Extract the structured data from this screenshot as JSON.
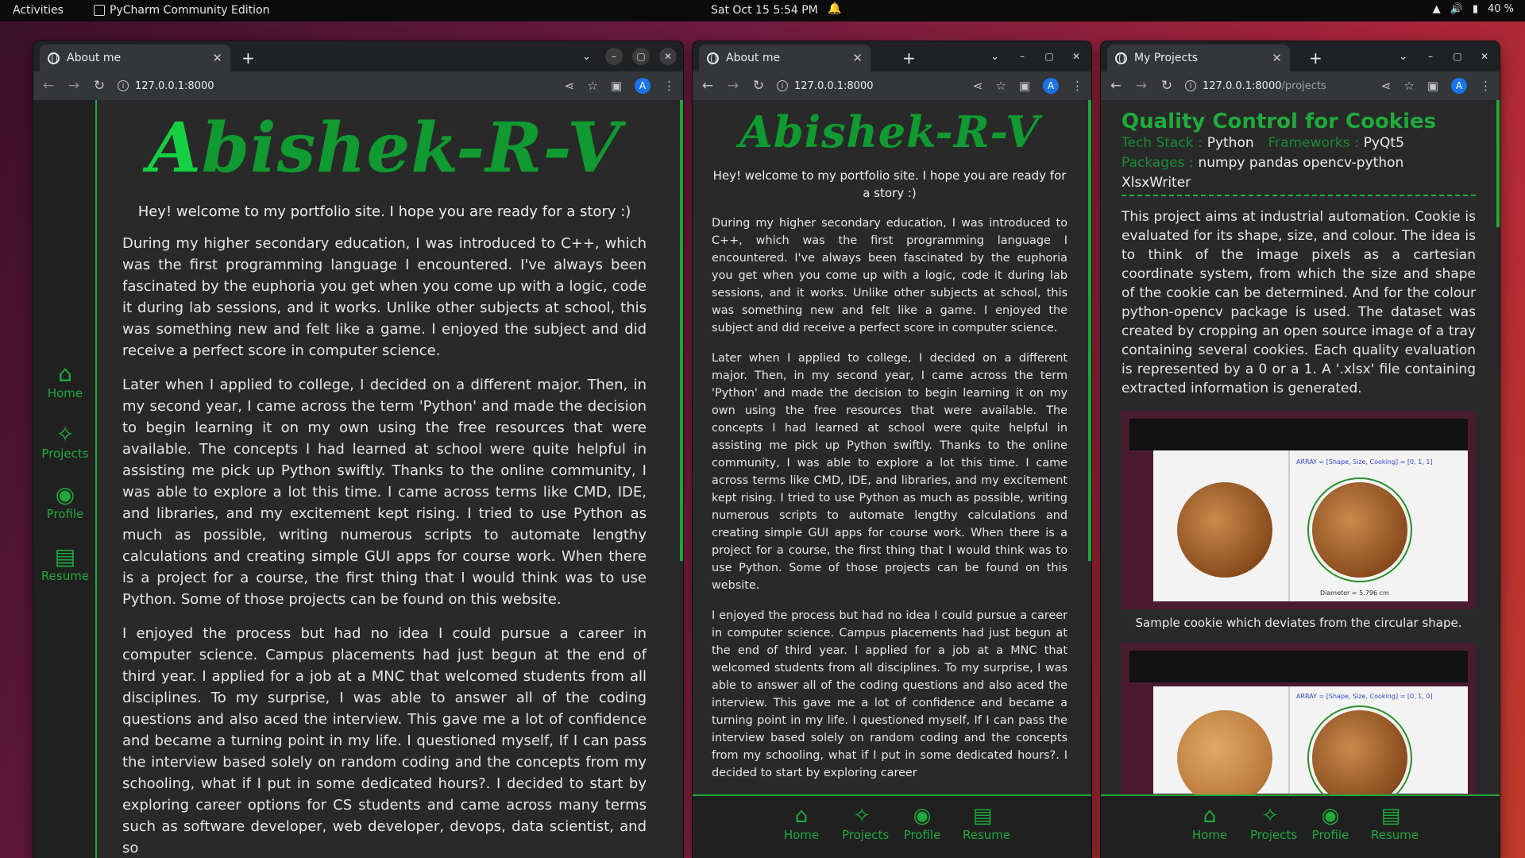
{
  "topbar": {
    "activities": "Activities",
    "app_name": "PyCharm Community Edition",
    "clock": "Sat Oct 15  5:54 PM",
    "battery": "40 %"
  },
  "icons": {
    "wifi": "wifi-icon",
    "volume": "volume-icon",
    "battery": "battery-icon",
    "bell": "bell-icon",
    "home": "home-icon",
    "projects": "magic-wand-icon",
    "profile": "github-icon",
    "resume": "pdf-icon"
  },
  "colors": {
    "accent_green": "#1faa3c",
    "page_bg": "#292929",
    "chrome_bg": "#35363a"
  },
  "window1": {
    "tab_title": "About me",
    "url": "127.0.0.1:8000",
    "logo_first": "A",
    "logo_rest": "bishek-R-V",
    "sidebar": {
      "home": "Home",
      "projects": "Projects",
      "profile": "Profile",
      "resume": "Resume"
    },
    "welcome": "Hey! welcome to my portfolio site. I hope you are ready for a story :)",
    "paragraphs": [
      "During my higher secondary education, I was introduced to C++, which was the first programming language I encountered. I've always been fascinated by the euphoria you get when you come up with a logic, code it during lab sessions, and it works. Unlike other subjects at school, this was something new and felt like a game. I enjoyed the subject and did receive a perfect score in computer science.",
      "Later when I applied to college, I decided on a different major. Then, in my second year, I came across the term 'Python' and made the decision to begin learning it on my own using the free resources that were available. The concepts I had learned at school were quite helpful in assisting me pick up Python swiftly. Thanks to the online community, I was able to explore a lot this time. I came across terms like CMD, IDE, and libraries, and my excitement kept rising. I tried to use Python as much as possible, writing numerous scripts to automate lengthy calculations and creating simple GUI apps for course work. When there is a project for a course, the first thing that I would think was to use Python. Some of those projects can be found on this website.",
      "I enjoyed the process but had no idea I could pursue a career in computer science. Campus placements had just begun at the end of third year. I applied for a job at a MNC that welcomed students from all disciplines. To my surprise, I was able to answer all of the coding questions and also aced the interview. This gave me a lot of confidence and became a turning point in my life. I questioned myself, If I can pass the interview based solely on random coding and the concepts from my schooling, what if I put in some dedicated hours?. I decided to start by exploring career options for CS students and came across many terms such as software developer, web developer, devops, data scientist, and so"
    ]
  },
  "window2": {
    "tab_title": "About me",
    "url": "127.0.0.1:8000",
    "logo": "Abishek-R-V",
    "welcome": "Hey! welcome to my portfolio site. I hope you are ready for a story :)",
    "paragraphs": [
      "During my higher secondary education, I was introduced to C++, which was the first programming language I encountered. I've always been fascinated by the euphoria you get when you come up with a logic, code it during lab sessions, and it works. Unlike other subjects at school, this was something new and felt like a game. I enjoyed the subject and did receive a perfect score in computer science.",
      "Later when I applied to college, I decided on a different major. Then, in my second year, I came across the term 'Python' and made the decision to begin learning it on my own using the free resources that were available. The concepts I had learned at school were quite helpful in assisting me pick up Python swiftly. Thanks to the online community, I was able to explore a lot this time. I came across terms like CMD, IDE, and libraries, and my excitement kept rising. I tried to use Python as much as possible, writing numerous scripts to automate lengthy calculations and creating simple GUI apps for course work. When there is a project for a course, the first thing that I would think was to use Python. Some of those projects can be found on this website.",
      "I enjoyed the process but had no idea I could pursue a career in computer science. Campus placements had just begun at the end of third year. I applied for a job at a MNC that welcomed students from all disciplines. To my surprise, I was able to answer all of the coding questions and also aced the interview. This gave me a lot of confidence and became a turning point in my life. I questioned myself, If I can pass the interview based solely on random coding and the concepts from my schooling, what if I put in some dedicated hours?. I decided to start by exploring career"
    ],
    "bottomnav": {
      "home": "Home",
      "projects": "Projects",
      "profile": "Profile",
      "resume": "Resume"
    }
  },
  "window3": {
    "tab_title": "My Projects",
    "url_host": "127.0.0.1:8000",
    "url_path": "/projects",
    "project_title": "Quality Control for Cookies",
    "tech_stack_label": "Tech Stack :",
    "tech_stack": "Python",
    "frameworks_label": "Frameworks :",
    "frameworks": "PyQt5",
    "packages_label": "Packages :",
    "packages": "numpy pandas opencv-python XlsxWriter",
    "description": "This project aims at industrial automation. Cookie is evaluated for its shape, size, and colour.  The idea is to think of the image pixels as a cartesian coordinate system, from which the size and shape of the cookie can be determined. And for the colour python-opencv package is used.  The dataset was created by cropping an open source image of a tray containing several cookies. Each quality evaluation is represented by a 0 or a 1. A '.xlsx' file containing extracted information is generated.",
    "screenshot1_array": "ARRAY = [Shape, Size, Cooking] = [0, 1, 1]",
    "screenshot1_diameter": "Diameter = 5.796 cm",
    "caption1": "Sample cookie which deviates from the circular shape.",
    "screenshot2_array": "ARRAY = [Shape, Size, Cooking] = [0, 1, 0]",
    "bottomnav": {
      "home": "Home",
      "projects": "Projects",
      "profile": "Profile",
      "resume": "Resume"
    }
  }
}
